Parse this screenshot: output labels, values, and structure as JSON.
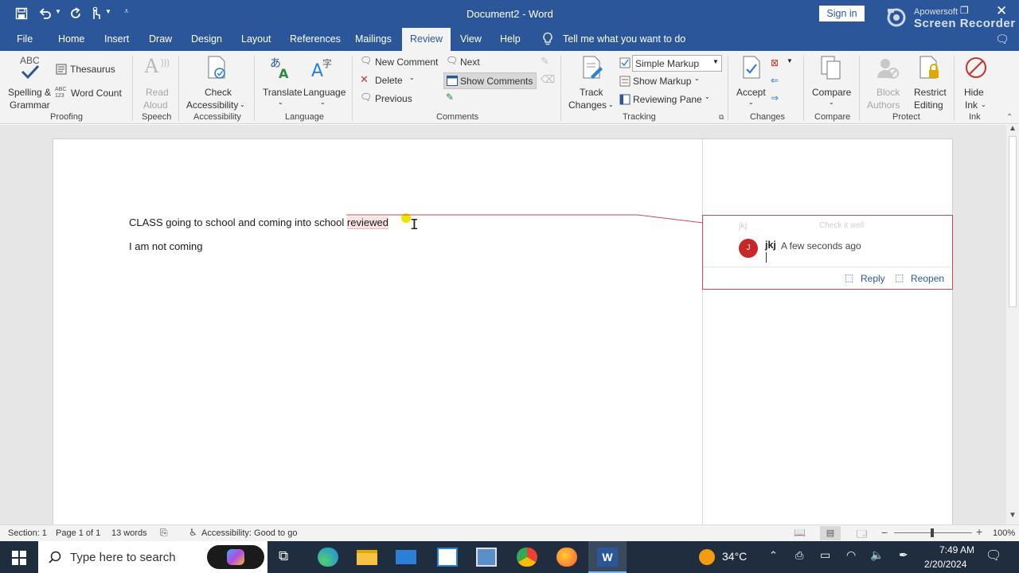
{
  "titlebar": {
    "doc_title": "Document2 - Word",
    "sign_in": "Sign in",
    "watermark_brand": "Apowersoft",
    "watermark_product": "Screen Recorder"
  },
  "tabs": [
    "File",
    "Home",
    "Insert",
    "Draw",
    "Design",
    "Layout",
    "References",
    "Mailings",
    "Review",
    "View",
    "Help"
  ],
  "active_tab": "Review",
  "tell_me": "Tell me what you want to do",
  "ribbon": {
    "proofing": {
      "spelling": "Spelling &",
      "grammar": "Grammar",
      "thesaurus": "Thesaurus",
      "word_count": "Word Count",
      "label": "Proofing",
      "abc": "ABC"
    },
    "speech": {
      "read": "Read",
      "aloud": "Aloud",
      "label": "Speech"
    },
    "accessibility": {
      "check": "Check",
      "acc": "Accessibility",
      "label": "Accessibility"
    },
    "language": {
      "translate": "Translate",
      "language": "Language",
      "label": "Language"
    },
    "comments": {
      "new": "New Comment",
      "delete": "Delete",
      "previous": "Previous",
      "next": "Next",
      "show": "Show Comments",
      "label": "Comments"
    },
    "tracking": {
      "track": "Track",
      "changes": "Changes",
      "markup_select": "Simple Markup",
      "show_markup": "Show Markup",
      "reviewing_pane": "Reviewing Pane",
      "label": "Tracking"
    },
    "changes": {
      "accept": "Accept",
      "label": "Changes"
    },
    "compare": {
      "compare": "Compare",
      "label": "Compare"
    },
    "protect": {
      "block": "Block",
      "authors": "Authors",
      "restrict": "Restrict",
      "editing": "Editing",
      "label": "Protect"
    },
    "ink": {
      "hide": "Hide",
      "ink": "Ink",
      "label": "Ink"
    }
  },
  "document": {
    "line1_main": "CLASS going to school and coming into school",
    "line1_commented": "reviewed",
    "line2": "I am not coming"
  },
  "comment": {
    "faded_author": "jkj",
    "faded_text": "Check it well",
    "avatar_initial": "J",
    "author": "jkj",
    "time": "A few seconds ago",
    "reply": "Reply",
    "reopen": "Reopen",
    "accent": "#c84a4a"
  },
  "status": {
    "section": "Section: 1",
    "page": "Page 1 of 1",
    "words": "13 words",
    "accessibility": "Accessibility: Good to go",
    "zoom": "100%"
  },
  "taskbar": {
    "search_placeholder": "Type here to search",
    "temperature": "34°C",
    "time": "7:49 AM",
    "date": "2/20/2024"
  },
  "colors": {
    "word_blue": "#2b579a",
    "taskbar": "#1f2d3f"
  }
}
